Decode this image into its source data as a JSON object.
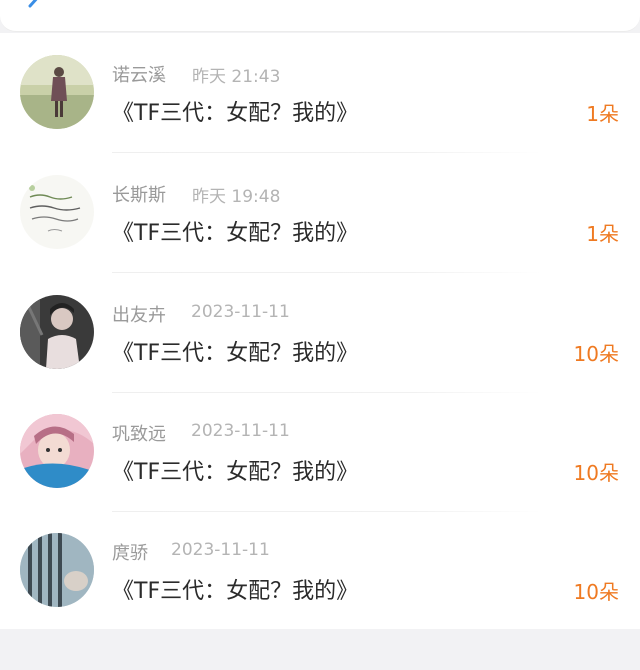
{
  "header": {
    "back_icon": "chevron-left-icon",
    "accent_color": "#3a8ee6"
  },
  "accent": {
    "flower_count_color": "#ef7a22"
  },
  "rows": [
    {
      "name": "诺云溪",
      "time": "昨天 21:43",
      "title": "《TF三代：女配？我的》",
      "flowers": "1朵",
      "avatar": "girl-in-field-avatar"
    },
    {
      "name": "长斯斯",
      "time": "昨天 19:48",
      "title": "《TF三代：女配？我的》",
      "flowers": "1朵",
      "avatar": "handwritten-text-avatar"
    },
    {
      "name": "出友卉",
      "time": "2023-11-11",
      "title": "《TF三代：女配？我的》",
      "flowers": "10朵",
      "avatar": "boy-portrait-avatar"
    },
    {
      "name": "巩致远",
      "time": "2023-11-11",
      "title": "《TF三代：女配？我的》",
      "flowers": "10朵",
      "avatar": "anime-girl-avatar"
    },
    {
      "name": "庹骄",
      "time": "2023-11-11",
      "title": "《TF三代：女配？我的》",
      "flowers": "10朵",
      "avatar": "window-bars-avatar"
    }
  ]
}
